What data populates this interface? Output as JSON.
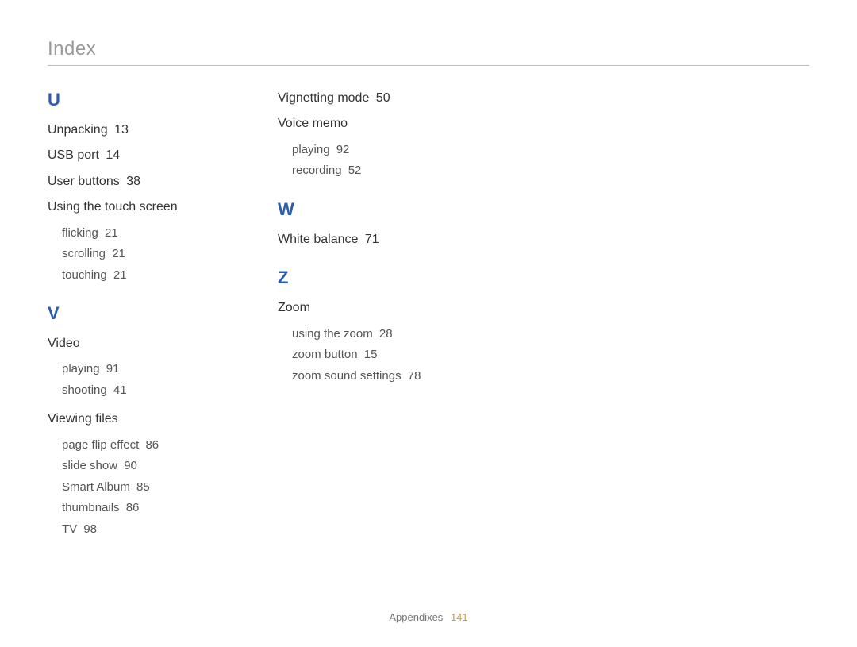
{
  "page_title": "Index",
  "footer": {
    "section": "Appendixes",
    "page": "141"
  },
  "col1": {
    "letterU": "U",
    "unpacking": {
      "label": "Unpacking",
      "page": "13"
    },
    "usb_port": {
      "label": "USB port",
      "page": "14"
    },
    "user_buttons": {
      "label": "User buttons",
      "page": "38"
    },
    "touch_screen": {
      "label": "Using the touch screen"
    },
    "flicking": {
      "label": "flicking",
      "page": "21"
    },
    "scrolling": {
      "label": "scrolling",
      "page": "21"
    },
    "touching": {
      "label": "touching",
      "page": "21"
    },
    "letterV": "V",
    "video": {
      "label": "Video"
    },
    "video_playing": {
      "label": "playing",
      "page": "91"
    },
    "video_shooting": {
      "label": "shooting",
      "page": "41"
    },
    "viewing_files": {
      "label": "Viewing files"
    },
    "page_flip": {
      "label": "page flip effect",
      "page": "86"
    },
    "slide_show": {
      "label": "slide show",
      "page": "90"
    },
    "smart_album": {
      "label": "Smart Album",
      "page": "85"
    },
    "thumbnails": {
      "label": "thumbnails",
      "page": "86"
    },
    "tv": {
      "label": "TV",
      "page": "98"
    }
  },
  "col2": {
    "vignetting": {
      "label": "Vignetting mode",
      "page": "50"
    },
    "voice_memo": {
      "label": "Voice memo"
    },
    "vm_playing": {
      "label": "playing",
      "page": "92"
    },
    "vm_recording": {
      "label": "recording",
      "page": "52"
    },
    "letterW": "W",
    "white_balance": {
      "label": "White balance",
      "page": "71"
    },
    "letterZ": "Z",
    "zoom": {
      "label": "Zoom"
    },
    "using_zoom": {
      "label": "using the zoom",
      "page": "28"
    },
    "zoom_button": {
      "label": "zoom button",
      "page": "15"
    },
    "zoom_sound": {
      "label": "zoom sound settings",
      "page": "78"
    }
  }
}
